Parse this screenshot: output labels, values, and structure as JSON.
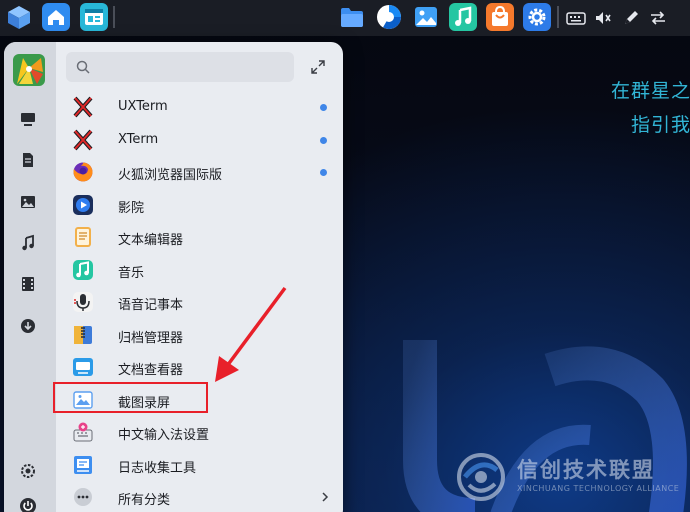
{
  "desktop": {
    "tagline_line1": "在群星之",
    "tagline_line2": "指引我",
    "watermark_title": "信创技术联盟",
    "watermark_subtitle": "XINCHUANG TECHNOLOGY ALLIANCE"
  },
  "top_panel": {
    "left_icons": [
      "kylin-cube-icon",
      "home-folder-icon",
      "window-manager-icon"
    ],
    "launcher_icons": [
      "file-manager-icon",
      "browser-icon",
      "image-viewer-icon",
      "music-icon",
      "software-store-icon",
      "settings-icon"
    ],
    "tray_icons": [
      "keyboard-icon",
      "volume-icon",
      "pen-icon",
      "switch-icon"
    ]
  },
  "start_menu": {
    "search": {
      "value": "",
      "placeholder": ""
    },
    "sidebar_icons": [
      "computer-icon",
      "document-icon",
      "picture-icon",
      "music-note-icon",
      "video-icon",
      "download-icon",
      "settings-icon",
      "power-icon"
    ],
    "apps": [
      {
        "label": "UXTerm",
        "icon": "terminal-x-icon",
        "new": true
      },
      {
        "label": "XTerm",
        "icon": "terminal-x-icon",
        "new": true
      },
      {
        "label": "火狐浏览器国际版",
        "icon": "firefox-icon",
        "new": true
      },
      {
        "label": "影院",
        "icon": "video-player-icon",
        "new": false
      },
      {
        "label": "文本编辑器",
        "icon": "text-editor-icon",
        "new": false
      },
      {
        "label": "音乐",
        "icon": "music-icon",
        "new": false
      },
      {
        "label": "语音记事本",
        "icon": "voice-recorder-icon",
        "new": false
      },
      {
        "label": "归档管理器",
        "icon": "archive-manager-icon",
        "new": false
      },
      {
        "label": "文档查看器",
        "icon": "document-viewer-icon",
        "new": false
      },
      {
        "label": "截图录屏",
        "icon": "screenshot-icon",
        "new": false
      },
      {
        "label": "中文输入法设置",
        "icon": "input-method-icon",
        "new": false
      },
      {
        "label": "日志收集工具",
        "icon": "log-collector-icon",
        "new": false
      },
      {
        "label": "所有分类",
        "icon": "more-dots-icon",
        "new": false
      }
    ]
  },
  "colors": {
    "accent_blue": "#3f86e8",
    "highlight_red": "#e8202a",
    "tagline_cyan": "#32b5d6"
  }
}
